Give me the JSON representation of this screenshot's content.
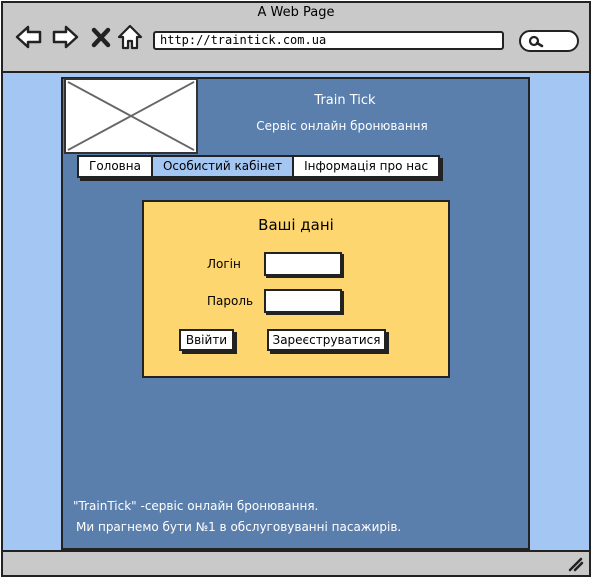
{
  "window": {
    "title": "A Web Page"
  },
  "browser": {
    "url": "http://traintick.com.ua",
    "back_icon": "arrow-left-icon",
    "forward_icon": "arrow-right-icon",
    "stop_icon": "close-icon",
    "home_icon": "home-icon",
    "search_icon": "search-icon"
  },
  "site": {
    "title": "Train Tick",
    "subtitle": "Сервіс онлайн бронювання"
  },
  "nav": {
    "tabs": [
      {
        "label": "Головна"
      },
      {
        "label": "Особистий кабінет",
        "active": true
      },
      {
        "label": "Інформація про нас"
      }
    ]
  },
  "login": {
    "title": "Ваші дані",
    "login_label": "Логін",
    "login_value": "",
    "password_label": "Пароль",
    "password_value": "",
    "submit_label": "Ввійти",
    "register_label": "Зареєструватися"
  },
  "footer": {
    "line1": "\"TrainTick\" -сервіс онлайн бронювання.",
    "line2": "Ми прагнемо бути №1 в обслуговуванні пасажирів."
  },
  "colors": {
    "chrome": "#c9c9c9",
    "page_bg": "#a4c6f3",
    "panel": "#5a7fac",
    "card": "#fed66f",
    "active_tab": "#a4c6f3"
  }
}
